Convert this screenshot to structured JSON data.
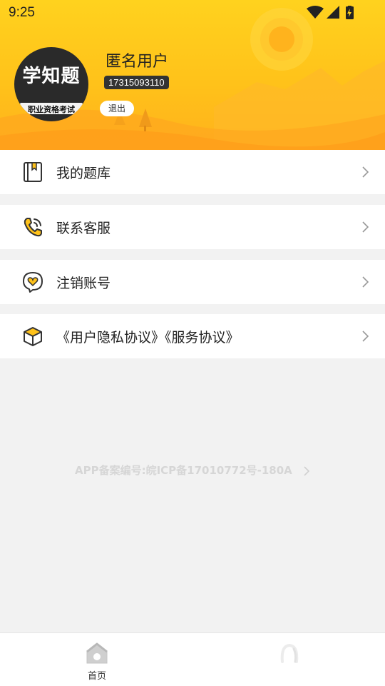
{
  "status_bar": {
    "time": "9:25"
  },
  "profile": {
    "avatar_title": "学知题",
    "avatar_subtitle": "职业资格考试",
    "username": "匿名用户",
    "phone": "17315093110",
    "logout_label": "退出"
  },
  "menu": [
    {
      "label": "我的题库",
      "icon": "question-bank-book-icon"
    },
    {
      "label": "联系客服",
      "icon": "phone-icon"
    },
    {
      "label": "注销账号",
      "icon": "heart-chat-icon"
    },
    {
      "label": "《用户隐私协议》《服务协议》",
      "icon": "box-cube-icon"
    }
  ],
  "footer": {
    "icp": "APP备案编号:皖ICP备17010772号-180A"
  },
  "bottom_nav": {
    "home_label": "首页"
  },
  "colors": {
    "accent": "#ffc21a",
    "card": "#ffffff",
    "background": "#f2f2f2"
  }
}
